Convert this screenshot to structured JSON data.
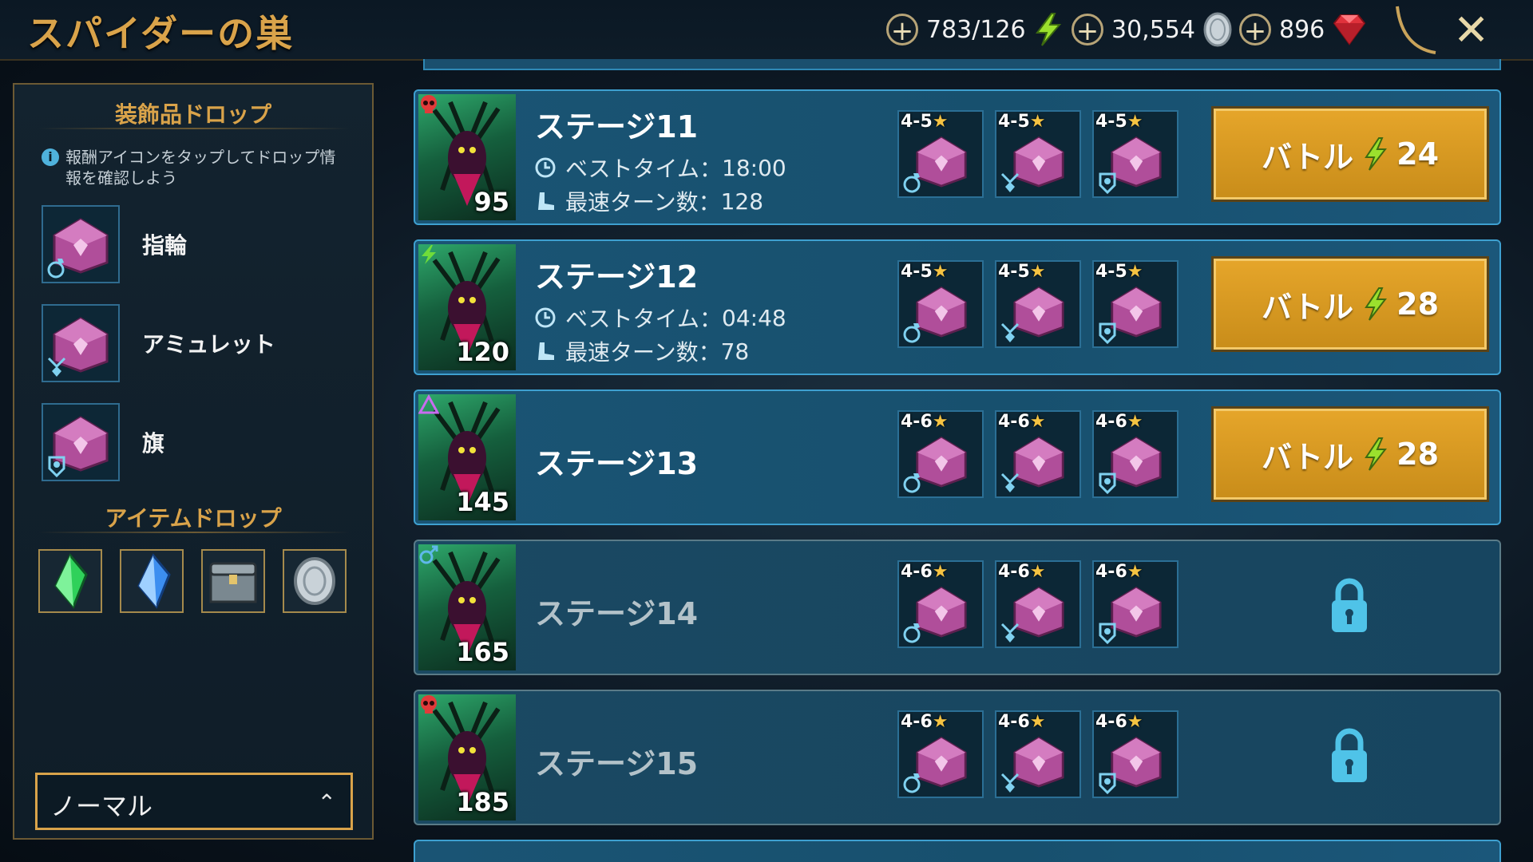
{
  "header": {
    "title": "スパイダーの巣",
    "energy": "783/126",
    "silver": "30,554",
    "gems": "896"
  },
  "sidebar": {
    "artifact_title": "装飾品ドロップ",
    "info_text": "報酬アイコンをタップしてドロップ情報を確認しよう",
    "artifacts": [
      {
        "label": "指輪",
        "slot": "ring-icon"
      },
      {
        "label": "アミュレット",
        "slot": "amulet-icon"
      },
      {
        "label": "旗",
        "slot": "banner-icon"
      }
    ],
    "item_title": "アイテムドロップ",
    "items": [
      "green-shard-icon",
      "blue-shard-icon",
      "chest-icon",
      "silver-coin-icon"
    ],
    "difficulty": "ノーマル"
  },
  "stages": [
    {
      "name": "ステージ11",
      "power": "95",
      "affinity": "skull",
      "best_label": "ベストタイム：",
      "best": "18:00",
      "turns_label": "最速ターン数：",
      "turns": "128",
      "rewards": [
        "4-5",
        "4-5",
        "4-5"
      ],
      "battle_label": "バトル",
      "energy": "24",
      "locked": false
    },
    {
      "name": "ステージ12",
      "power": "120",
      "affinity": "bolt",
      "best_label": "ベストタイム：",
      "best": "04:48",
      "turns_label": "最速ターン数：",
      "turns": "78",
      "rewards": [
        "4-5",
        "4-5",
        "4-5"
      ],
      "battle_label": "バトル",
      "energy": "28",
      "locked": false
    },
    {
      "name": "ステージ13",
      "power": "145",
      "affinity": "triangle",
      "rewards": [
        "4-6",
        "4-6",
        "4-6"
      ],
      "battle_label": "バトル",
      "energy": "28",
      "locked": false
    },
    {
      "name": "ステージ14",
      "power": "165",
      "affinity": "male",
      "rewards": [
        "4-6",
        "4-6",
        "4-6"
      ],
      "locked": true
    },
    {
      "name": "ステージ15",
      "power": "185",
      "affinity": "skull",
      "rewards": [
        "4-6",
        "4-6",
        "4-6"
      ],
      "locked": true
    }
  ],
  "colors": {
    "accent_gold": "#d9a34a",
    "stage_border": "#3ea0d0",
    "battle_button": "#e0a025",
    "lock_icon": "#4fc3e8"
  }
}
